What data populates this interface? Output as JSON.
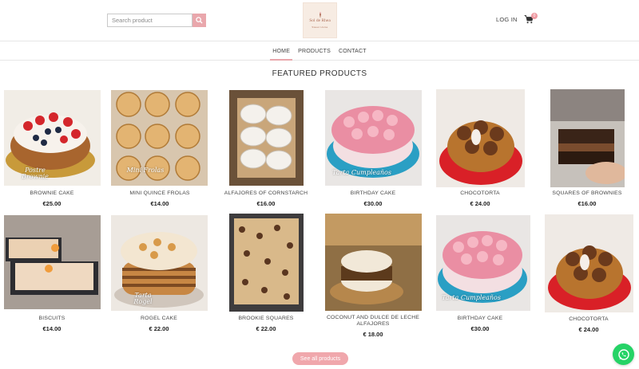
{
  "header": {
    "search_placeholder": "Search product",
    "search_icon": "search-icon",
    "logo_text": "Sol de Rhea",
    "logo_subtext": "Sweet Home",
    "login_label": "LOG IN",
    "cart_icon": "cart-icon",
    "cart_count": "0"
  },
  "nav": {
    "items": [
      {
        "label": "HOME",
        "active": true
      },
      {
        "label": "PRODUCTS",
        "active": false
      },
      {
        "label": "CONTACT",
        "active": false
      }
    ]
  },
  "main": {
    "section_title": "FEATURED PRODUCTS",
    "products": [
      {
        "name": "BROWNIE CAKE",
        "price": "€25.00",
        "overlay": "Postre Brownie"
      },
      {
        "name": "MINI QUINCE FROLAS",
        "price": "€14.00",
        "overlay": "Mini Frolas"
      },
      {
        "name": "ALFAJORES OF CORNSTARCH",
        "price": "€16.00",
        "overlay": ""
      },
      {
        "name": "BIRTHDAY CAKE",
        "price": "€30.00",
        "overlay": "Tarta Cumpleaños"
      },
      {
        "name": "CHOCOTORTA",
        "price": "€ 24.00",
        "overlay": ""
      },
      {
        "name": "SQUARES OF BROWNIES",
        "price": "€16.00",
        "overlay": ""
      },
      {
        "name": "BISCUITS",
        "price": "€14.00",
        "overlay": ""
      },
      {
        "name": "ROGEL CAKE",
        "price": "€ 22.00",
        "overlay": "Tarta Rogel"
      },
      {
        "name": "BROOKIE SQUARES",
        "price": "€ 22.00",
        "overlay": ""
      },
      {
        "name": "COCONUT AND DULCE DE LECHE ALFAJORES",
        "price": "€ 18.00",
        "overlay": ""
      },
      {
        "name": "BIRTHDAY CAKE",
        "price": "€30.00",
        "overlay": "Tarta Cumpleaños"
      },
      {
        "name": "CHOCOTORTA",
        "price": "€ 24.00",
        "overlay": ""
      }
    ],
    "see_all_label": "See all products"
  },
  "widgets": {
    "whatsapp_icon": "whatsapp-icon"
  },
  "colors": {
    "accent": "#e9a7ac",
    "whatsapp": "#25d366"
  }
}
